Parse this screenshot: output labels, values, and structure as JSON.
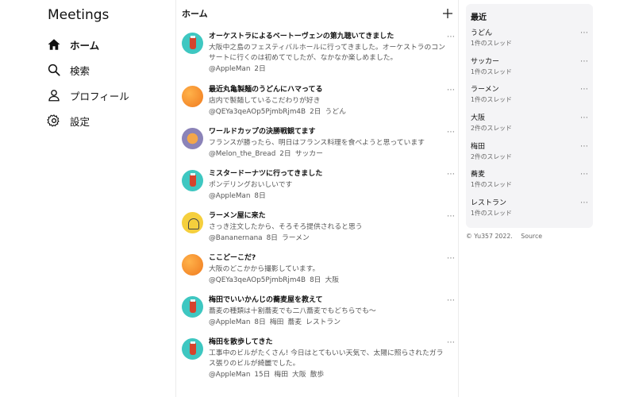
{
  "app": {
    "title": "Meetings"
  },
  "nav": {
    "items": [
      {
        "label": "ホーム",
        "icon": "home-icon",
        "active": true
      },
      {
        "label": "検索",
        "icon": "search-icon",
        "active": false
      },
      {
        "label": "プロフィール",
        "icon": "user-icon",
        "active": false
      },
      {
        "label": "設定",
        "icon": "gear-icon",
        "active": false
      }
    ]
  },
  "main": {
    "title": "ホーム",
    "new_post_icon": "plus-icon"
  },
  "posts": [
    {
      "avatar": "teal-drink",
      "title": "オーケストラによるベートーヴェンの第九聴いてきました",
      "text": "大阪中之島のフェスティバルホールに行ってきました。オーケストラのコンサートに行くのは初めてでしたが、なかなか楽しめました。",
      "user": "@AppleMan",
      "time": "2日",
      "tags": []
    },
    {
      "avatar": "orange",
      "title": "最近丸亀製麺のうどんにハマってる",
      "text": "店内で製麺しているこだわりが好き",
      "user": "@QEYa3qeAOp5PjmbRjm4B",
      "time": "2日",
      "tags": [
        "うどん"
      ]
    },
    {
      "avatar": "purple-bread",
      "title": "ワールドカップの決勝戦観てます",
      "text": "フランスが勝ったら、明日はフランス料理を食べようと思っています",
      "user": "@Melon_the_Bread",
      "time": "2日",
      "tags": [
        "サッカー"
      ]
    },
    {
      "avatar": "teal-drink",
      "title": "ミスタードーナツに行ってきました",
      "text": "ポンデリングおいしいです",
      "user": "@AppleMan",
      "time": "8日",
      "tags": []
    },
    {
      "avatar": "yellow",
      "title": "ラーメン屋に来た",
      "text": "さっき注文したから、そろそろ提供されると思う",
      "user": "@Bananernana",
      "time": "8日",
      "tags": [
        "ラーメン"
      ]
    },
    {
      "avatar": "orange",
      "title": "ここどーこだ?",
      "text": "大阪のどこかから撮影しています。",
      "user": "@QEYa3qeAOp5PjmbRjm4B",
      "time": "8日",
      "tags": [
        "大阪"
      ]
    },
    {
      "avatar": "teal-drink",
      "title": "梅田でいいかんじの蕎麦屋を教えて",
      "text": "蕎麦の種類は十割蕎麦でも二八蕎麦でもどちらでも〜",
      "user": "@AppleMan",
      "time": "8日",
      "tags": [
        "梅田",
        "蕎麦",
        "レストラン"
      ]
    },
    {
      "avatar": "teal-drink",
      "title": "梅田を散歩してきた",
      "text": "工事中のビルがたくさん! 今日はとてもいい天気で、太陽に照らされたガラス張りのビルが綺麗でした。",
      "user": "@AppleMan",
      "time": "15日",
      "tags": [
        "梅田",
        "大阪",
        "散歩"
      ]
    }
  ],
  "recent": {
    "title": "最近",
    "items": [
      {
        "name": "うどん",
        "count": "1件のスレッド"
      },
      {
        "name": "サッカー",
        "count": "1件のスレッド"
      },
      {
        "name": "ラーメン",
        "count": "1件のスレッド"
      },
      {
        "name": "大阪",
        "count": "2件のスレッド"
      },
      {
        "name": "梅田",
        "count": "2件のスレッド"
      },
      {
        "name": "蕎麦",
        "count": "1件のスレッド"
      },
      {
        "name": "レストラン",
        "count": "1件のスレッド"
      }
    ]
  },
  "footer": {
    "copyright": "© Yu357 2022.",
    "source": "Source"
  },
  "colors": {
    "teal": "#3ec7c1",
    "orange": "#f07a1f",
    "yellow": "#f5cf3d",
    "panel": "#f4f4f6"
  }
}
